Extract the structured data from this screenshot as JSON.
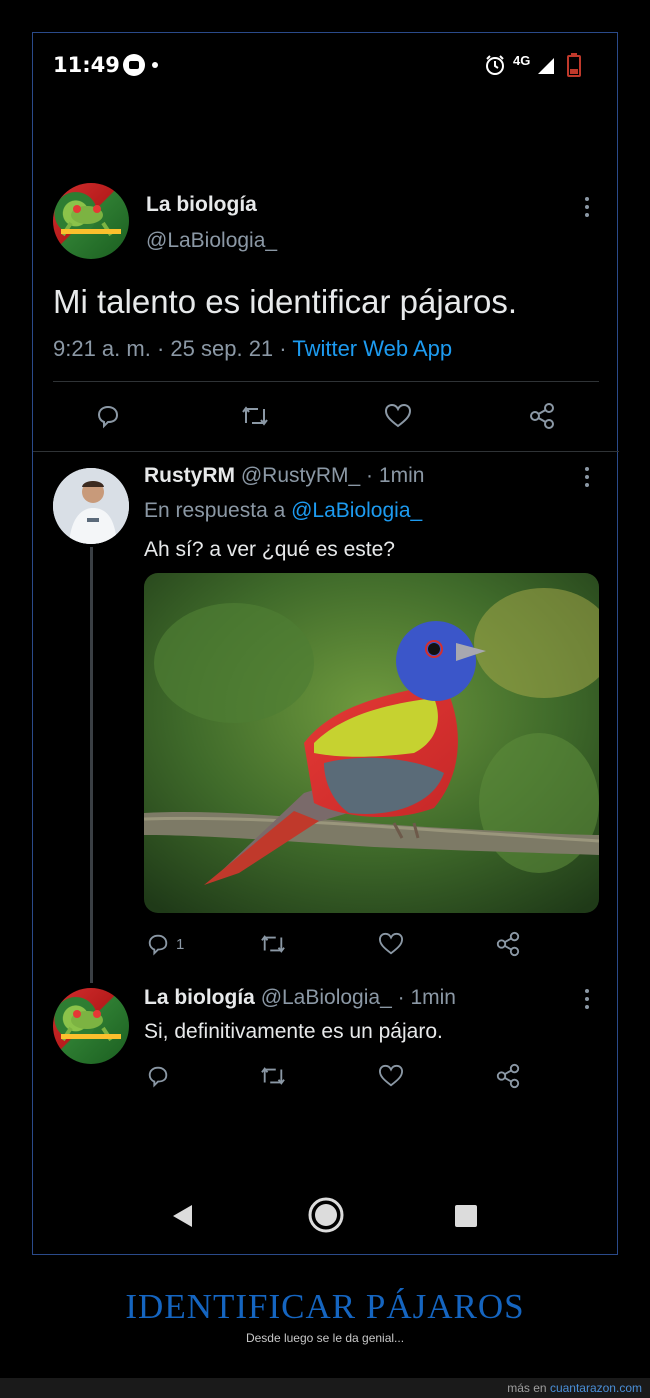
{
  "status_bar": {
    "time": "11:49",
    "network": "4G"
  },
  "tweet": {
    "author_name": "La biología",
    "author_handle": "@LaBiologia_",
    "text": "Mi talento es identificar pájaros.",
    "time": "9:21 a. m.",
    "date": "25 sep. 21",
    "sep": "·",
    "app": "Twitter Web App"
  },
  "reply1": {
    "author_name": "RustyRM",
    "author_handle": "@RustyRM_",
    "age": "1min",
    "sep": "·",
    "replying_label": "En respuesta a",
    "replying_to": "@LaBiologia_",
    "text": "Ah sí? a ver ¿qué es este?",
    "reply_count": "1"
  },
  "reply2": {
    "author_name": "La biología",
    "author_handle": "@LaBiologia_",
    "age": "1min",
    "sep": "·",
    "text": "Si, definitivamente es un pájaro."
  },
  "caption": {
    "title": "IDENTIFICAR PÁJAROS",
    "subtitle": "Desde luego se le da genial..."
  },
  "footer": {
    "prefix": "más en",
    "site": "cuantarazon.com"
  },
  "colors": {
    "link": "#1d9bf0",
    "caption": "#1565c0",
    "muted": "#8b98a5"
  },
  "icons": [
    "alarm-icon",
    "signal-icon",
    "battery-icon",
    "reply-icon",
    "retweet-icon",
    "like-icon",
    "share-icon",
    "more-icon",
    "back-icon",
    "home-icon",
    "recents-icon"
  ]
}
